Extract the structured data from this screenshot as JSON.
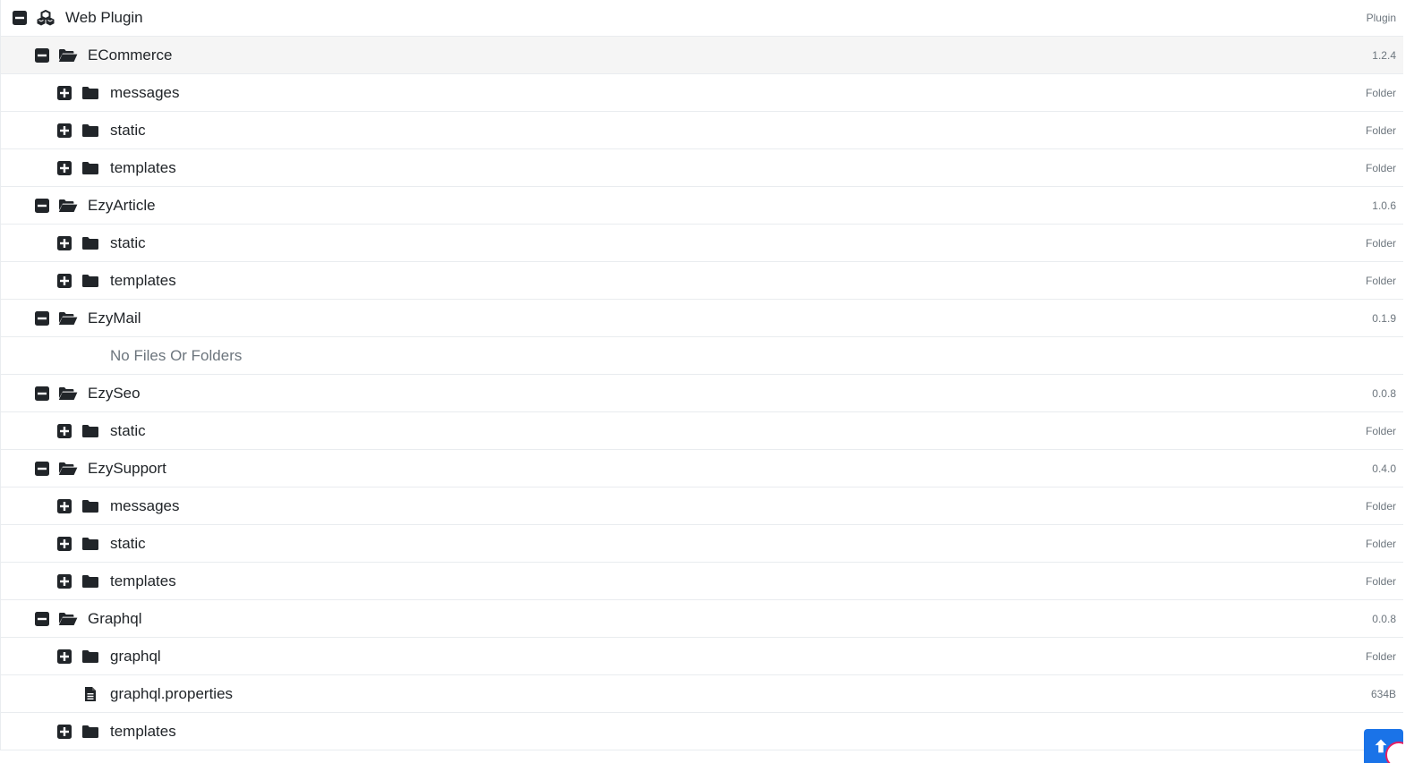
{
  "colors": {
    "border": "#e9ecef",
    "highlight_row": "#f5f5f5",
    "meta_text": "#6c757d",
    "icon": "#212529",
    "fab": "#1a73e8"
  },
  "tree": [
    {
      "level": 0,
      "type": "root",
      "toggle": "minus",
      "icon": "cubes-icon",
      "label": "Web Plugin",
      "meta": "Plugin"
    },
    {
      "level": 1,
      "type": "plugin",
      "toggle": "minus",
      "icon": "folder-open-icon",
      "label": "ECommerce",
      "meta": "1.2.4",
      "highlight": true
    },
    {
      "level": 2,
      "type": "folder",
      "toggle": "plus",
      "icon": "folder-icon",
      "label": "messages",
      "meta": "Folder"
    },
    {
      "level": 2,
      "type": "folder",
      "toggle": "plus",
      "icon": "folder-icon",
      "label": "static",
      "meta": "Folder"
    },
    {
      "level": 2,
      "type": "folder",
      "toggle": "plus",
      "icon": "folder-icon",
      "label": "templates",
      "meta": "Folder"
    },
    {
      "level": 1,
      "type": "plugin",
      "toggle": "minus",
      "icon": "folder-open-icon",
      "label": "EzyArticle",
      "meta": "1.0.6"
    },
    {
      "level": 2,
      "type": "folder",
      "toggle": "plus",
      "icon": "folder-icon",
      "label": "static",
      "meta": "Folder"
    },
    {
      "level": 2,
      "type": "folder",
      "toggle": "plus",
      "icon": "folder-icon",
      "label": "templates",
      "meta": "Folder"
    },
    {
      "level": 1,
      "type": "plugin",
      "toggle": "minus",
      "icon": "folder-open-icon",
      "label": "EzyMail",
      "meta": "0.1.9"
    },
    {
      "level": 2,
      "type": "empty",
      "label": "No Files Or Folders",
      "meta": ""
    },
    {
      "level": 1,
      "type": "plugin",
      "toggle": "minus",
      "icon": "folder-open-icon",
      "label": "EzySeo",
      "meta": "0.0.8"
    },
    {
      "level": 2,
      "type": "folder",
      "toggle": "plus",
      "icon": "folder-icon",
      "label": "static",
      "meta": "Folder"
    },
    {
      "level": 1,
      "type": "plugin",
      "toggle": "minus",
      "icon": "folder-open-icon",
      "label": "EzySupport",
      "meta": "0.4.0"
    },
    {
      "level": 2,
      "type": "folder",
      "toggle": "plus",
      "icon": "folder-icon",
      "label": "messages",
      "meta": "Folder"
    },
    {
      "level": 2,
      "type": "folder",
      "toggle": "plus",
      "icon": "folder-icon",
      "label": "static",
      "meta": "Folder"
    },
    {
      "level": 2,
      "type": "folder",
      "toggle": "plus",
      "icon": "folder-icon",
      "label": "templates",
      "meta": "Folder"
    },
    {
      "level": 1,
      "type": "plugin",
      "toggle": "minus",
      "icon": "folder-open-icon",
      "label": "Graphql",
      "meta": "0.0.8"
    },
    {
      "level": 2,
      "type": "folder",
      "toggle": "plus",
      "icon": "folder-icon",
      "label": "graphql",
      "meta": "Folder"
    },
    {
      "level": 2,
      "type": "file",
      "icon": "file-text-icon",
      "label": "graphql.properties",
      "meta": "634B"
    },
    {
      "level": 2,
      "type": "folder",
      "toggle": "plus",
      "icon": "folder-icon",
      "label": "templates",
      "meta": ""
    }
  ],
  "fab": {
    "icon": "scroll-top-icon"
  }
}
